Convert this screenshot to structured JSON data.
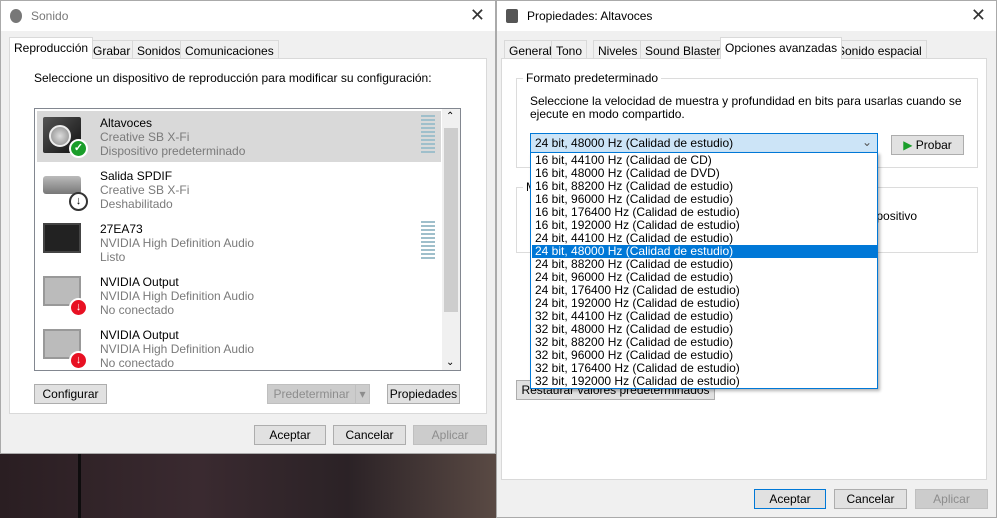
{
  "sound_window": {
    "title": "Sonido",
    "tabs": [
      "Reproducción",
      "Grabar",
      "Sonidos",
      "Comunicaciones"
    ],
    "instruction": "Seleccione un dispositivo de reproducción para modificar su configuración:",
    "devices": [
      {
        "name": "Altavoces",
        "driver": "Creative SB X-Fi",
        "status": "Dispositivo predeterminado",
        "icon": "speaker-icon",
        "badge": "check",
        "selected": true
      },
      {
        "name": "Salida SPDIF",
        "driver": "Creative SB X-Fi",
        "status": "Deshabilitado",
        "icon": "receiver-icon",
        "badge": "down-arrow"
      },
      {
        "name": "27EA73",
        "driver": "NVIDIA High Definition Audio",
        "status": "Listo",
        "icon": "monitor-icon",
        "badge": "none"
      },
      {
        "name": "NVIDIA Output",
        "driver": "NVIDIA High Definition Audio",
        "status": "No conectado",
        "icon": "monitor-icon",
        "badge": "red-down-arrow"
      },
      {
        "name": "NVIDIA Output",
        "driver": "NVIDIA High Definition Audio",
        "status": "No conectado",
        "icon": "monitor-icon",
        "badge": "red-down-arrow"
      }
    ],
    "configure": "Configurar",
    "set_default": "Predeterminar",
    "properties": "Propiedades",
    "ok": "Aceptar",
    "cancel": "Cancelar",
    "apply": "Aplicar"
  },
  "props_window": {
    "title": "Propiedades: Altavoces",
    "tabs": [
      "General",
      "Tono",
      "Niveles",
      "Sound Blaster",
      "Opciones avanzadas",
      "Sonido espacial"
    ],
    "active_tab": "Opciones avanzadas",
    "format_group": "Formato predeterminado",
    "format_desc": "Seleccione la velocidad de muestra y profundidad en bits para usarlas cuando se ejecute en modo compartido.",
    "format_value": "24 bit, 48000 Hz (Calidad de estudio)",
    "test": "Probar",
    "exclusive_group_partial": "M",
    "exclusive_text_partial": "dispositivo",
    "restore": "Restaurar valores predeterminados",
    "options": [
      "16 bit, 44100 Hz (Calidad de CD)",
      "16 bit, 48000 Hz (Calidad de DVD)",
      "16 bit, 88200 Hz (Calidad de estudio)",
      "16 bit, 96000 Hz (Calidad de estudio)",
      "16 bit, 176400 Hz (Calidad de estudio)",
      "16 bit, 192000 Hz (Calidad de estudio)",
      "24 bit, 44100 Hz (Calidad de estudio)",
      "24 bit, 48000 Hz (Calidad de estudio)",
      "24 bit, 88200 Hz (Calidad de estudio)",
      "24 bit, 96000 Hz (Calidad de estudio)",
      "24 bit, 176400 Hz (Calidad de estudio)",
      "24 bit, 192000 Hz (Calidad de estudio)",
      "32 bit, 44100 Hz (Calidad de estudio)",
      "32 bit, 48000 Hz (Calidad de estudio)",
      "32 bit, 88200 Hz (Calidad de estudio)",
      "32 bit, 96000 Hz (Calidad de estudio)",
      "32 bit, 176400 Hz (Calidad de estudio)",
      "32 bit, 192000 Hz (Calidad de estudio)"
    ],
    "highlighted_index": 7,
    "ok": "Aceptar",
    "cancel": "Cancelar",
    "apply": "Aplicar"
  },
  "colors": {
    "accent": "#0078d7",
    "check": "#1a9e2a",
    "error": "#e81123"
  }
}
